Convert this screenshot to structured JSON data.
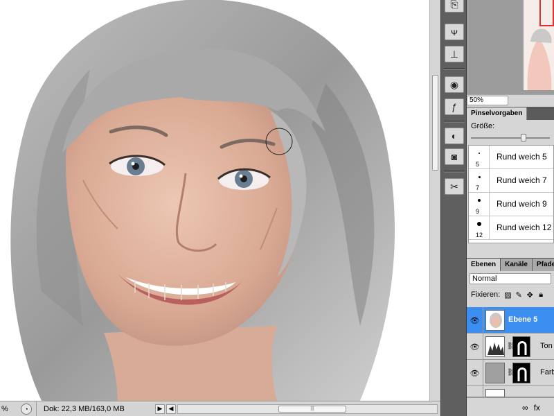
{
  "statusbar": {
    "zoom": "%",
    "doc_info": "Dok: 22,3 MB/163,0 MB",
    "play_arrow": "▶",
    "left_arrow": "◀"
  },
  "navigator": {
    "zoom_value": "50%"
  },
  "brush_panel": {
    "tab_label": "Pinselvorgaben",
    "size_label": "Größe:",
    "size_fraction": 0.68,
    "brushes": [
      {
        "num": "5",
        "name": "Rund weich 5"
      },
      {
        "num": "7",
        "name": "Rund weich 7"
      },
      {
        "num": "9",
        "name": "Rund weich 9"
      },
      {
        "num": "12",
        "name": "Rund weich 12"
      }
    ]
  },
  "layers_panel": {
    "tabs": [
      "Ebenen",
      "Kanäle",
      "Pfade"
    ],
    "blend_mode": "Normal",
    "lock_label": "Fixieren:",
    "layers": [
      {
        "name": "Ebene 5",
        "selected": true
      },
      {
        "name": "Ton",
        "selected": false
      },
      {
        "name": "Farb",
        "selected": false
      }
    ],
    "footer": {
      "link_icon": "∞",
      "fx_label": "fx"
    }
  },
  "toolstrip": {
    "icons": [
      "history-icon",
      "actions-icon",
      "clone-source-icon",
      "styles-icon",
      "fx-icon",
      "adjustments-icon",
      "masks-icon",
      "tools-icon"
    ]
  },
  "colors": {
    "panel_bg": "#d6d6d6",
    "dark_bg": "#535353",
    "selected_layer": "#3d8ef1",
    "navigator_box": "#e03030"
  }
}
